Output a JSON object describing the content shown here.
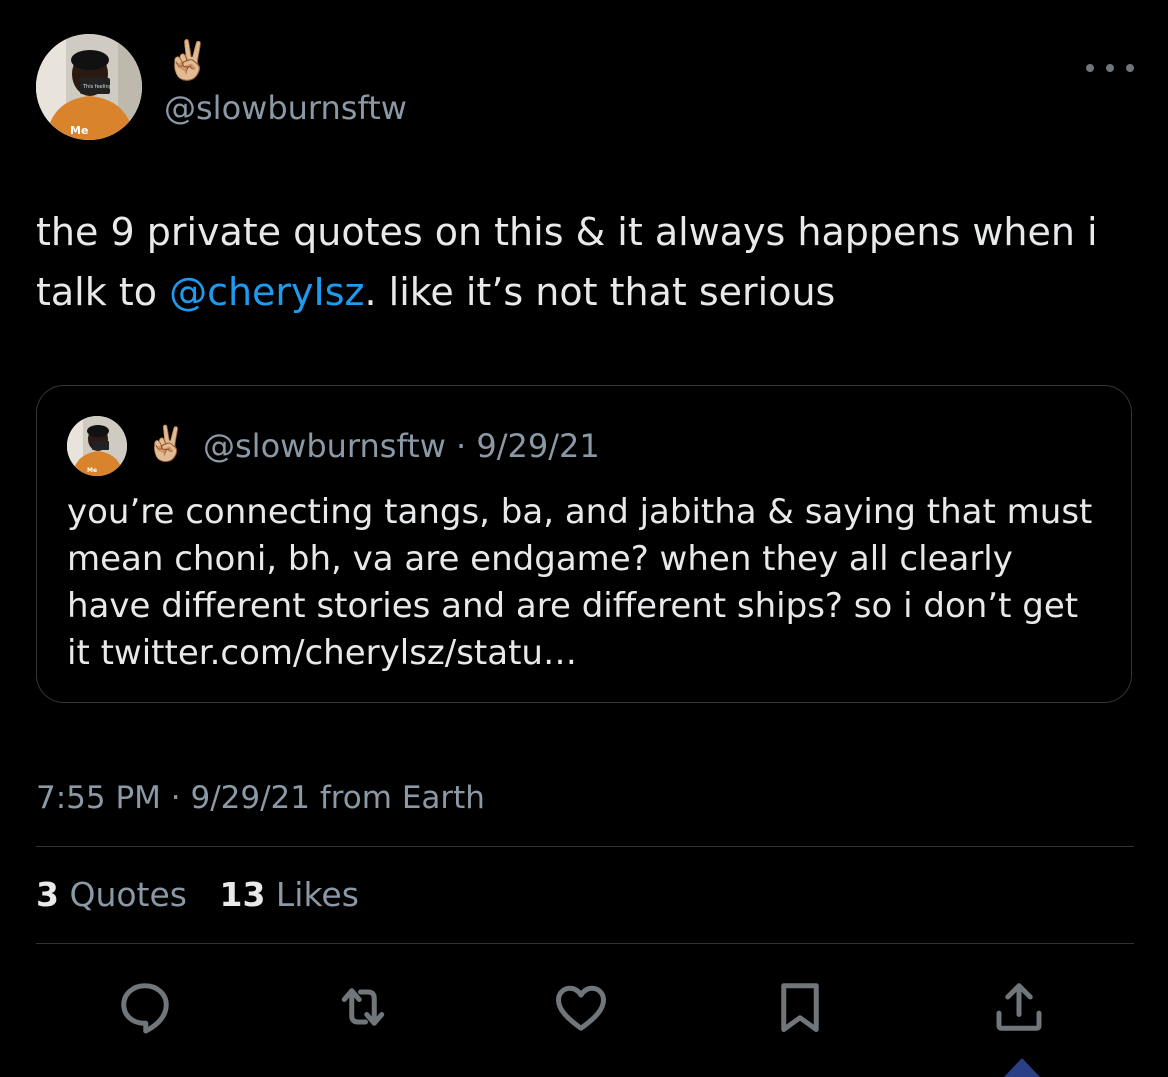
{
  "author": {
    "display_name": "✌🏼",
    "handle": "@slowburnsftw",
    "avatar_caption": "Me",
    "avatar_card_text": "This feeling"
  },
  "tweet": {
    "text_before_mention": "the 9 private quotes on this & it always happens when i talk to ",
    "mention": "@cheryIsz",
    "text_after_mention": ". like it’s not that serious"
  },
  "quoted_tweet": {
    "display_name": "✌🏼",
    "meta": "@slowburnsftw · 9/29/21",
    "avatar_caption": "Me",
    "text": "you’re connecting tangs, ba, and jabitha & saying that must mean choni, bh, va are endgame? when they all clearly have different stories and are different ships? so i don’t get it twitter.com/cherylsz/statu…"
  },
  "timestamp": "7:55 PM · 9/29/21 from Earth",
  "stats": {
    "quotes_count": "3",
    "quotes_label": "Quotes",
    "likes_count": "13",
    "likes_label": "Likes"
  },
  "actions": [
    {
      "icon": "reply-icon"
    },
    {
      "icon": "retweet-icon"
    },
    {
      "icon": "like-icon"
    },
    {
      "icon": "bookmark-icon"
    },
    {
      "icon": "share-icon"
    }
  ],
  "colors": {
    "background": "#000000",
    "text": "#e7e9ea",
    "secondary_text": "#8b98a5",
    "link": "#1d9bf0",
    "border": "#333639",
    "icon": "#71767b"
  }
}
